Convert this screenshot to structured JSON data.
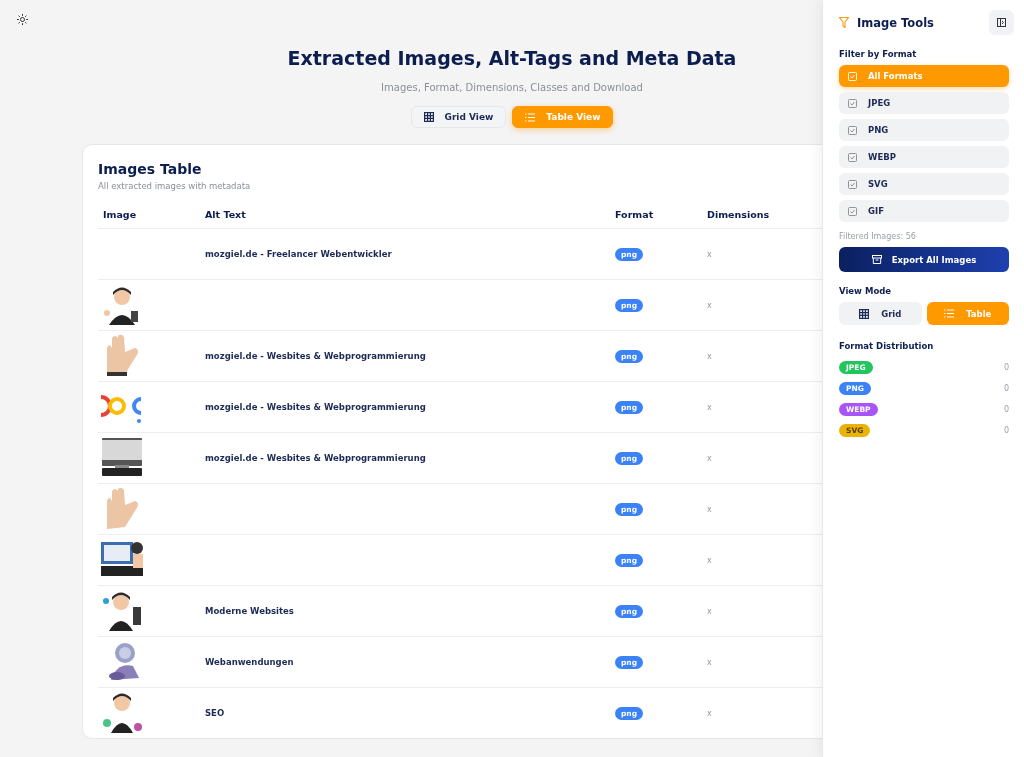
{
  "header": {
    "title": "Extracted Images, Alt-Tags and Meta Data",
    "subtitle": "Images, Format, Dimensions, Classes and Download",
    "views": [
      {
        "label": "Grid View",
        "kind": "grid",
        "selected": false
      },
      {
        "label": "Table View",
        "kind": "list",
        "selected": true
      }
    ]
  },
  "table": {
    "title": "Images Table",
    "subtitle": "All extracted images with metadata",
    "columns": [
      "Image",
      "Alt Text",
      "Format",
      "Dimensions"
    ],
    "rows": [
      {
        "alt": "mozgiel.de - Freelancer Webentwickler",
        "format": "png",
        "dimensions": "x"
      },
      {
        "format": "png",
        "dimensions": "x"
      },
      {
        "alt": "mozgiel.de - Wesbites & Webprogrammierung",
        "format": "png",
        "dimensions": "x"
      },
      {
        "alt": "mozgiel.de - Wesbites & Webprogrammierung",
        "format": "png",
        "dimensions": "x"
      },
      {
        "alt": "mozgiel.de - Wesbites & Webprogrammierung",
        "format": "png",
        "dimensions": "x"
      },
      {
        "format": "png",
        "dimensions": "x"
      },
      {
        "format": "png",
        "dimensions": "x"
      },
      {
        "alt": "Moderne Websites",
        "format": "png",
        "dimensions": "x"
      },
      {
        "alt": "Webanwendungen",
        "format": "png",
        "dimensions": "x"
      },
      {
        "alt": "SEO",
        "format": "png",
        "dimensions": "x"
      }
    ]
  },
  "sidebar": {
    "title": "Image Tools",
    "filter_heading": "Filter by Format",
    "filters": [
      {
        "label": "All Formats",
        "selected": true
      },
      {
        "label": "JPEG",
        "selected": false
      },
      {
        "label": "PNG",
        "selected": false
      },
      {
        "label": "WEBP",
        "selected": false
      },
      {
        "label": "SVG",
        "selected": false
      },
      {
        "label": "GIF",
        "selected": false
      }
    ],
    "filtered_count": "Filtered Images: 56",
    "export_button": "Export All Images",
    "view_mode_heading": "View Mode",
    "view_modes": [
      {
        "label": "Grid",
        "kind": "grid",
        "selected": false
      },
      {
        "label": "Table",
        "kind": "list",
        "selected": true
      }
    ],
    "distribution_heading": "Format Distribution",
    "distribution": [
      {
        "label": "JPEG",
        "color": "#22c55e",
        "count": "0"
      },
      {
        "label": "PNG",
        "color": "#3b82f6",
        "count": "0"
      },
      {
        "label": "WEBP",
        "color": "#a855f7",
        "count": "0"
      },
      {
        "label": "SVG",
        "color": "#eab308",
        "count": "0"
      }
    ]
  }
}
